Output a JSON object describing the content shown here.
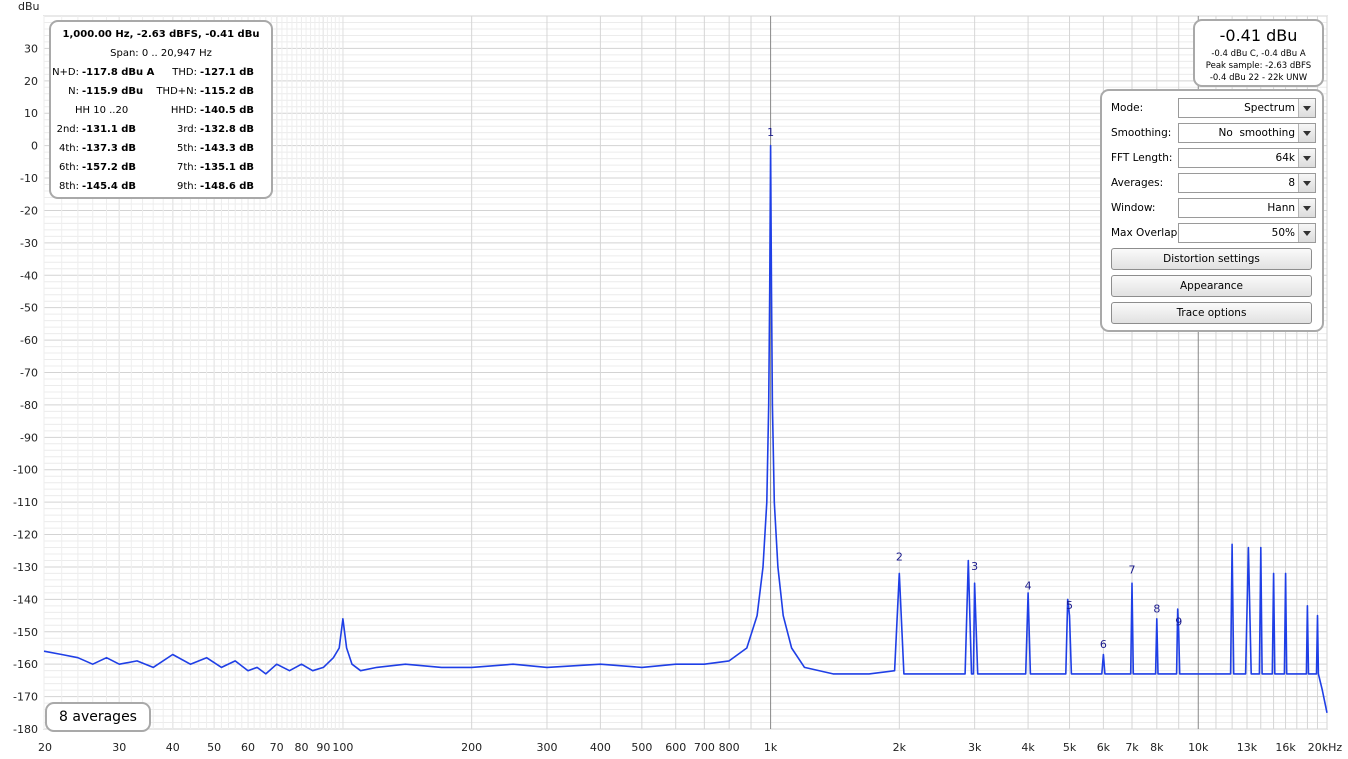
{
  "chart_data": {
    "type": "line",
    "title": "",
    "ylabel": "dBu",
    "xlabel": "",
    "x_scale": "log",
    "xlim": [
      20,
      20000
    ],
    "ylim": [
      -180,
      40
    ],
    "grid": true,
    "y_ticks": [
      30,
      20,
      10,
      0,
      -10,
      -20,
      -30,
      -40,
      -50,
      -60,
      -70,
      -80,
      -90,
      -100,
      -110,
      -120,
      -130,
      -140,
      -150,
      -160,
      -170,
      -180
    ],
    "x_ticks": [
      {
        "v": 20,
        "label": "20"
      },
      {
        "v": 30,
        "label": "30"
      },
      {
        "v": 40,
        "label": "40"
      },
      {
        "v": 50,
        "label": "50"
      },
      {
        "v": 60,
        "label": "60"
      },
      {
        "v": 70,
        "label": "70"
      },
      {
        "v": 80,
        "label": "80"
      },
      {
        "v": 90,
        "label": "90"
      },
      {
        "v": 100,
        "label": "100"
      },
      {
        "v": 200,
        "label": "200"
      },
      {
        "v": 300,
        "label": "300"
      },
      {
        "v": 400,
        "label": "400"
      },
      {
        "v": 500,
        "label": "500"
      },
      {
        "v": 600,
        "label": "600"
      },
      {
        "v": 700,
        "label": "700"
      },
      {
        "v": 800,
        "label": "800"
      },
      {
        "v": 1000,
        "label": "1k"
      },
      {
        "v": 2000,
        "label": "2k"
      },
      {
        "v": 3000,
        "label": "3k"
      },
      {
        "v": 4000,
        "label": "4k"
      },
      {
        "v": 5000,
        "label": "5k"
      },
      {
        "v": 6000,
        "label": "6k"
      },
      {
        "v": 7000,
        "label": "7k"
      },
      {
        "v": 8000,
        "label": "8k"
      },
      {
        "v": 10000,
        "label": "10k"
      },
      {
        "v": 13000,
        "label": "13k"
      },
      {
        "v": 16000,
        "label": "16k"
      },
      {
        "v": 20000,
        "label": "20kHz"
      }
    ],
    "series": [
      {
        "color": "#1f3fe6",
        "x": [
          20,
          22,
          24,
          26,
          28,
          30,
          33,
          36,
          40,
          44,
          48,
          52,
          56,
          60,
          63,
          66,
          70,
          75,
          80,
          85,
          90,
          95,
          98,
          100,
          102,
          105,
          110,
          120,
          140,
          170,
          200,
          250,
          300,
          400,
          500,
          600,
          700,
          800,
          880,
          930,
          960,
          980,
          990,
          995,
          1000,
          1005,
          1010,
          1020,
          1040,
          1070,
          1120,
          1200,
          1400,
          1700,
          1950,
          2000,
          2050,
          2500,
          2850,
          2900,
          2950,
          2980,
          3000,
          3050,
          3500,
          3950,
          4000,
          4050,
          4500,
          4900,
          4950,
          5000,
          5050,
          5500,
          5950,
          6000,
          6050,
          6500,
          6950,
          7000,
          7050,
          7500,
          7950,
          8000,
          8050,
          8500,
          8900,
          8950,
          9000,
          9050,
          9500,
          10000,
          11000,
          11900,
          12000,
          12100,
          12900,
          13100,
          13300,
          13900,
          14000,
          14100,
          14900,
          15000,
          15100,
          15900,
          16000,
          16100,
          17000,
          17900,
          18000,
          18100,
          18900,
          19000,
          19100,
          19500,
          20000
        ],
        "y": [
          -156,
          -157,
          -158,
          -160,
          -158,
          -160,
          -159,
          -161,
          -157,
          -160,
          -158,
          -161,
          -159,
          -162,
          -161,
          -163,
          -160,
          -162,
          -160,
          -162,
          -161,
          -158,
          -155,
          -146,
          -155,
          -160,
          -162,
          -161,
          -160,
          -161,
          -161,
          -160,
          -161,
          -160,
          -161,
          -160,
          -160,
          -159,
          -155,
          -145,
          -130,
          -110,
          -80,
          -45,
          0,
          -45,
          -80,
          -110,
          -130,
          -145,
          -155,
          -161,
          -163,
          -163,
          -162,
          -132,
          -163,
          -163,
          -163,
          -128,
          -163,
          -163,
          -135,
          -163,
          -163,
          -163,
          -138,
          -163,
          -163,
          -163,
          -140,
          -145,
          -163,
          -163,
          -163,
          -157,
          -163,
          -163,
          -163,
          -135,
          -163,
          -163,
          -163,
          -146,
          -163,
          -163,
          -163,
          -143,
          -150,
          -163,
          -163,
          -163,
          -163,
          -163,
          -123,
          -163,
          -163,
          -124,
          -163,
          -163,
          -124,
          -163,
          -163,
          -132,
          -163,
          -163,
          -132,
          -163,
          -163,
          -163,
          -142,
          -163,
          -163,
          -145,
          -163,
          -168,
          -175
        ]
      }
    ],
    "peak_labels": [
      {
        "label": "1",
        "x": 1000,
        "y": 3
      },
      {
        "label": "2",
        "x": 2000,
        "y": -128
      },
      {
        "label": "3",
        "x": 3000,
        "y": -131
      },
      {
        "label": "4",
        "x": 4000,
        "y": -137
      },
      {
        "label": "5",
        "x": 5000,
        "y": -143
      },
      {
        "label": "6",
        "x": 6000,
        "y": -155
      },
      {
        "label": "7",
        "x": 7000,
        "y": -132
      },
      {
        "label": "8",
        "x": 8000,
        "y": -144
      },
      {
        "label": "9",
        "x": 9000,
        "y": -148
      }
    ]
  },
  "stats": {
    "title": "1,000.00 Hz, -2.63 dBFS, -0.41 dBu",
    "span": "Span: 0 .. 20,947 Hz",
    "rows": [
      {
        "l1": "N+D:",
        "v1": "-117.8 dBu A",
        "l2": "THD:",
        "v2": "-127.1 dB"
      },
      {
        "l1": "N:",
        "v1": "-115.9 dBu",
        "l2": "THD+N:",
        "v2": "-115.2 dB"
      },
      {
        "l1": "",
        "v1": "HH 10 ..20",
        "l2": "HHD:",
        "v2": "-140.5 dB"
      },
      {
        "l1": "2nd:",
        "v1": "-131.1 dB",
        "l2": "3rd:",
        "v2": "-132.8 dB"
      },
      {
        "l1": "4th:",
        "v1": "-137.3 dB",
        "l2": "5th:",
        "v2": "-143.3 dB"
      },
      {
        "l1": "6th:",
        "v1": "-157.2 dB",
        "l2": "7th:",
        "v2": "-135.1 dB"
      },
      {
        "l1": "8th:",
        "v1": "-145.4 dB",
        "l2": "9th:",
        "v2": "-148.6 dB"
      }
    ]
  },
  "level": {
    "main": "-0.41 dBu",
    "line1": "-0.4 dBu C, -0.4 dBu A",
    "line2": "Peak sample: -2.63 dBFS",
    "line3": "-0.4 dBu 22 - 22k UNW"
  },
  "controls": {
    "fields": [
      {
        "label": "Mode:",
        "value": "Spectrum"
      },
      {
        "label": "Smoothing:",
        "value": "No  smoothing"
      },
      {
        "label": "FFT Length:",
        "value": "64k"
      },
      {
        "label": "Averages:",
        "value": "8"
      },
      {
        "label": "Window:",
        "value": "Hann"
      },
      {
        "label": "Max Overlap:",
        "value": "50%"
      }
    ],
    "buttons": [
      "Distortion settings",
      "Appearance",
      "Trace options"
    ]
  },
  "badge": "8 averages"
}
